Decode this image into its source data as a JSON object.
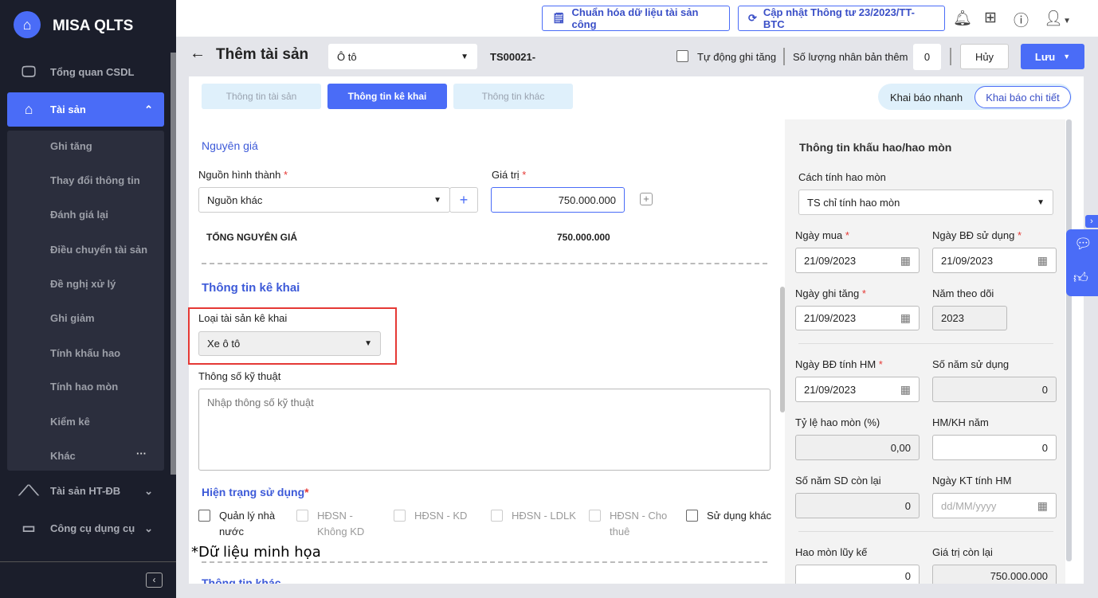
{
  "app": {
    "name": "MISA QLTS"
  },
  "sidebar": {
    "items": [
      {
        "label": "Tổng quan CSDL",
        "icon": "monitor-chart-icon"
      },
      {
        "label": "Tài sản",
        "icon": "house-car-icon"
      },
      {
        "label": "Tài sản HT-ĐB",
        "icon": "road-icon"
      },
      {
        "label": "Công cụ dụng cụ",
        "icon": "paint-roller-icon"
      }
    ],
    "sub_items": [
      "Ghi tăng",
      "Thay đổi thông tin",
      "Đánh giá lại",
      "Điều chuyển tài sản",
      "Đề nghị xử lý",
      "Ghi giảm",
      "Tính khấu hao",
      "Tính hao mòn",
      "Kiểm kê",
      "Khác"
    ]
  },
  "topbar": {
    "standardize": "Chuẩn hóa dữ liệu tài sản công",
    "update": "Cập nhật Thông tư 23/2023/TT-BTC"
  },
  "header": {
    "title": "Thêm tài sản",
    "asset_type": "Ô tô",
    "code": "TS00021-",
    "auto_label": "Tự động ghi tăng",
    "copies_label": "Số lượng nhân bản thêm",
    "copies": "0",
    "cancel": "Hủy",
    "save": "Lưu"
  },
  "tabs": [
    "Thông tin tài sản",
    "Thông tin kê khai",
    "Thông tin khác"
  ],
  "modes": {
    "quick": "Khai báo nhanh",
    "detail": "Khai báo chi tiết"
  },
  "nguyen_gia": {
    "title": "Nguyên giá",
    "source_label": "Nguồn hình thành",
    "source": "Nguồn khác",
    "value_label": "Giá trị",
    "value": "750.000.000",
    "total_label": "TỔNG NGUYÊN GIÁ",
    "total": "750.000.000"
  },
  "ke_khai": {
    "title": "Thông tin kê khai",
    "type_label": "Loại tài sản kê khai",
    "type": "Xe ô tô",
    "spec_label": "Thông số kỹ thuật",
    "spec_placeholder": "Nhập thông số kỹ thuật"
  },
  "hien_trang": {
    "title": "Hiện trạng sử dụng",
    "options": [
      {
        "label": "Quản lý nhà nước",
        "enabled": true
      },
      {
        "label": "HĐSN - Không KD",
        "enabled": false
      },
      {
        "label": "HĐSN - KD",
        "enabled": false
      },
      {
        "label": "HĐSN - LDLK",
        "enabled": false
      },
      {
        "label": "HĐSN - Cho thuê",
        "enabled": false
      },
      {
        "label": "Sử dụng khác",
        "enabled": true
      }
    ]
  },
  "watermark": "*Dữ liệu minh họa",
  "other_title": "Thông tin khác",
  "depr": {
    "title": "Thông tin khấu hao/hao mòn",
    "method_label": "Cách tính hao mòn",
    "method": "TS chỉ tính hao mòn",
    "buy_label": "Ngày mua",
    "buy": "21/09/2023",
    "use_label": "Ngày BĐ sử dụng",
    "use": "21/09/2023",
    "inc_label": "Ngày ghi tăng",
    "inc": "21/09/2023",
    "year_label": "Năm theo dõi",
    "year": "2023",
    "start_label": "Ngày BĐ tính HM",
    "start": "21/09/2023",
    "years_label": "Số năm sử dụng",
    "years": "0",
    "rate_label": "Tỷ lệ hao mòn (%)",
    "rate": "0,00",
    "annual_label": "HM/KH năm",
    "annual": "0",
    "remain_label": "Số năm SD còn lại",
    "remain": "0",
    "end_label": "Ngày KT tính HM",
    "end_placeholder": "dd/MM/yyyy",
    "accum_label": "Hao mòn lũy kế",
    "accum": "0",
    "residual_label": "Giá trị còn lại",
    "residual": "750.000.000"
  }
}
